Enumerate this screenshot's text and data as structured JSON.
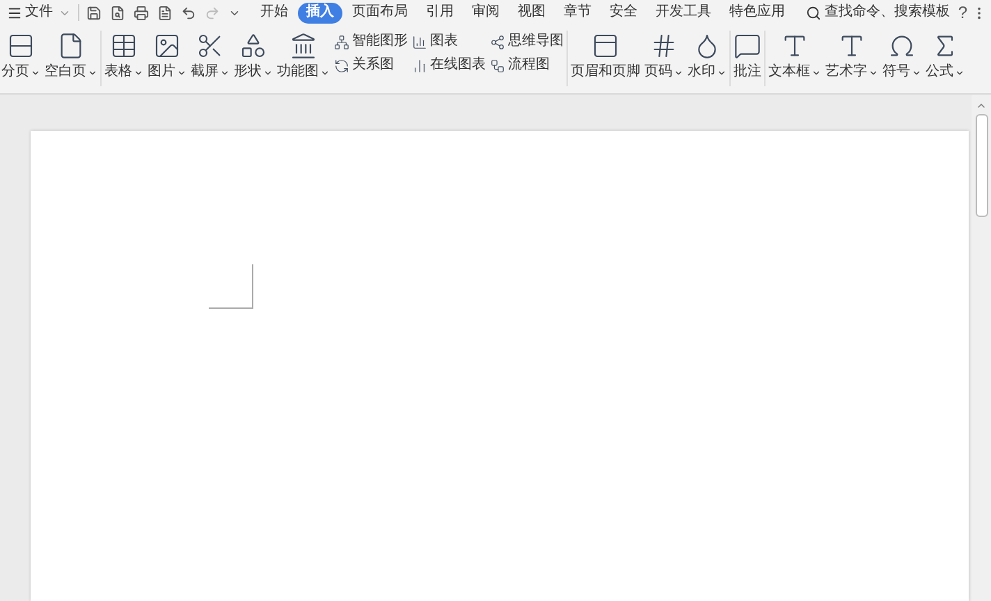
{
  "file_menu": {
    "label": "文件"
  },
  "tabs": [
    {
      "label": "开始",
      "selected": false
    },
    {
      "label": "插入",
      "selected": true
    },
    {
      "label": "页面布局",
      "selected": false
    },
    {
      "label": "引用",
      "selected": false
    },
    {
      "label": "审阅",
      "selected": false
    },
    {
      "label": "视图",
      "selected": false
    },
    {
      "label": "章节",
      "selected": false
    },
    {
      "label": "安全",
      "selected": false
    },
    {
      "label": "开发工具",
      "selected": false
    },
    {
      "label": "特色应用",
      "selected": false
    }
  ],
  "search": {
    "placeholder": "查找命令、搜索模板"
  },
  "help": {
    "label": "?"
  },
  "ribbon": [
    {
      "items": [
        {
          "kind": "large",
          "label": "分页",
          "dropdown": true
        },
        {
          "kind": "large",
          "label": "空白页",
          "dropdown": true
        }
      ]
    },
    {
      "items": [
        {
          "kind": "large",
          "label": "表格",
          "dropdown": true
        },
        {
          "kind": "large",
          "label": "图片",
          "dropdown": true
        },
        {
          "kind": "large",
          "label": "截屏",
          "dropdown": true
        },
        {
          "kind": "large",
          "label": "形状",
          "dropdown": true
        },
        {
          "kind": "large",
          "label": "功能图",
          "dropdown": true
        },
        {
          "kind": "stack",
          "buttons": [
            {
              "label": "智能图形"
            },
            {
              "label": "关系图"
            }
          ]
        },
        {
          "kind": "stack",
          "buttons": [
            {
              "label": "图表"
            },
            {
              "label": "在线图表"
            }
          ]
        },
        {
          "kind": "stack",
          "buttons": [
            {
              "label": "思维导图"
            },
            {
              "label": "流程图"
            }
          ]
        }
      ]
    },
    {
      "items": [
        {
          "kind": "large",
          "label": "页眉和页脚",
          "dropdown": false
        },
        {
          "kind": "large",
          "label": "页码",
          "dropdown": true
        },
        {
          "kind": "large",
          "label": "水印",
          "dropdown": true
        }
      ]
    },
    {
      "items": [
        {
          "kind": "large",
          "label": "批注",
          "dropdown": false
        }
      ]
    },
    {
      "items": [
        {
          "kind": "large",
          "label": "文本框",
          "dropdown": true
        },
        {
          "kind": "large",
          "label": "艺术字",
          "dropdown": true
        },
        {
          "kind": "large",
          "label": "符号",
          "dropdown": true
        },
        {
          "kind": "large",
          "label": "公式",
          "dropdown": true
        }
      ]
    }
  ]
}
